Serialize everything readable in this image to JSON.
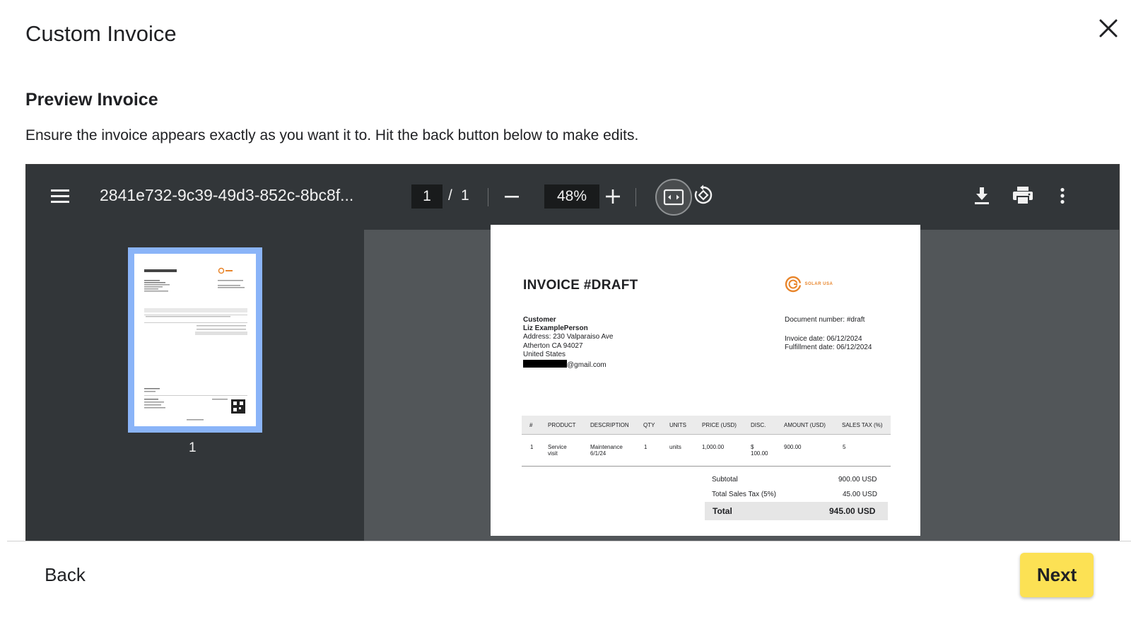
{
  "modal": {
    "title": "Custom Invoice",
    "section_title": "Preview Invoice",
    "description": "Ensure the invoice appears exactly as you want it to. Hit the back button below to make edits."
  },
  "viewer": {
    "filename": "2841e732-9c39-49d3-852c-8bc8f...",
    "current_page": "1",
    "page_separator": "/",
    "total_pages": "1",
    "zoom": "48%",
    "thumbnail_label": "1",
    "colors": {
      "toolbar": "#323639",
      "background": "#525659",
      "thumb_highlight": "#8ab4f8"
    }
  },
  "invoice": {
    "title": "INVOICE #DRAFT",
    "logo_text": "SOLAR USA",
    "logo_color": "#e8852b",
    "customer_heading": "Customer",
    "customer_name": "Liz ExamplePerson",
    "address_line1": "Address: 230 Valparaiso Ave",
    "address_line2": "Atherton CA 94027",
    "address_line3": "United States",
    "email_suffix": "@gmail.com",
    "document_number": "Document number: #draft",
    "invoice_date": "Invoice date: 06/12/2024",
    "fulfillment_date": "Fulfillment date: 06/12/2024",
    "table": {
      "headers": [
        "#",
        "PRODUCT",
        "DESCRIPTION",
        "QTY",
        "UNITS",
        "PRICE (USD)",
        "DISC.",
        "AMOUNT (USD)",
        "SALES TAX (%)"
      ],
      "rows": [
        {
          "num": "1",
          "product_line1": "Service",
          "product_line2": "visit",
          "desc_line1": "Maintenance",
          "desc_line2": "6/1/24",
          "qty": "1",
          "units": "units",
          "price": "1,000.00",
          "disc_line1": "$",
          "disc_line2": "100.00",
          "amount": "900.00",
          "tax": "5"
        }
      ]
    },
    "subtotal_label": "Subtotal",
    "subtotal_value": "900.00 USD",
    "tax_label": "Total Sales Tax (5%)",
    "tax_value": "45.00 USD",
    "total_label": "Total",
    "total_value": "945.00 USD"
  },
  "footer": {
    "back_label": "Back",
    "next_label": "Next",
    "next_color": "#fce154"
  }
}
